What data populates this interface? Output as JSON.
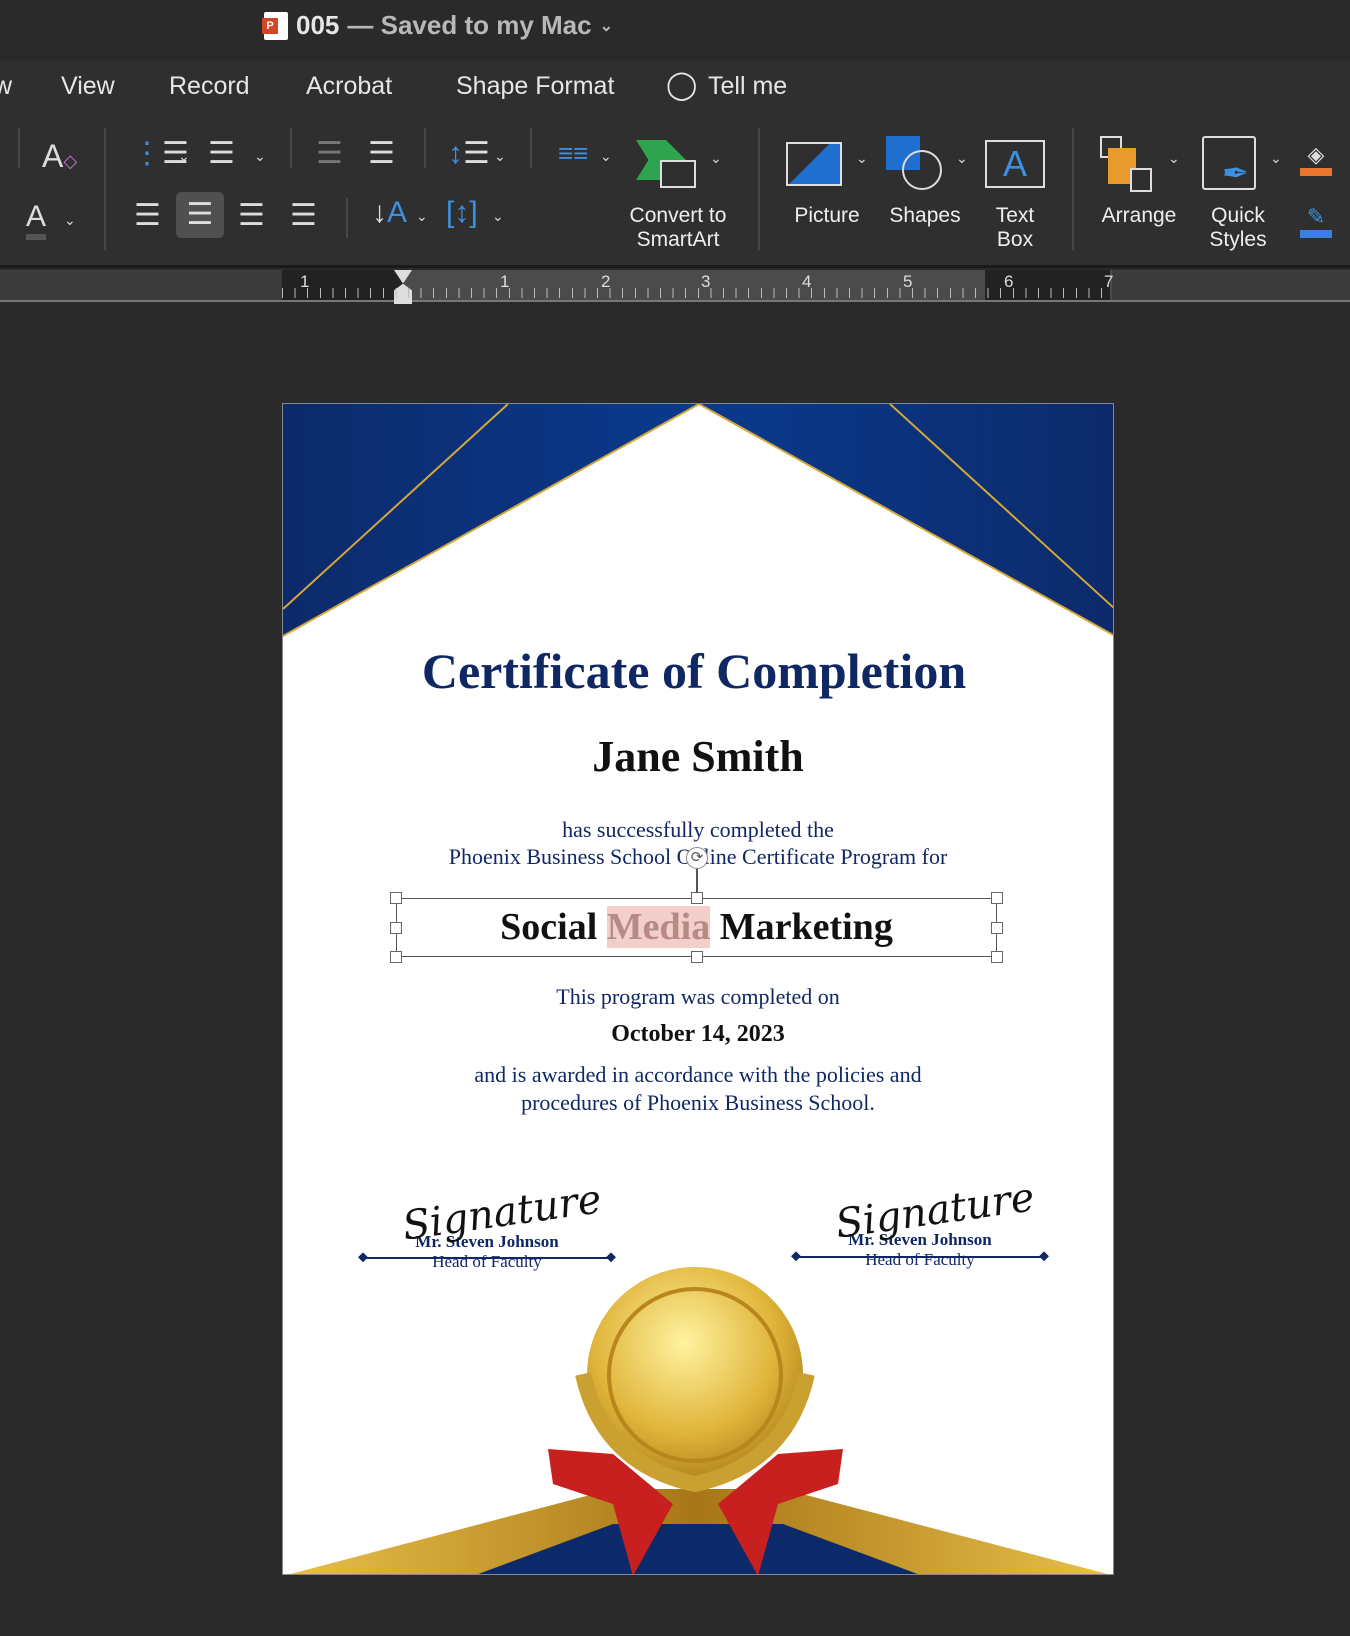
{
  "window": {
    "file_name": "005",
    "save_status": "— Saved to my Mac"
  },
  "menu": {
    "items": [
      "w",
      "View",
      "Record",
      "Acrobat",
      "Shape Format"
    ],
    "tell_me": "Tell me"
  },
  "ribbon": {
    "convert_smartart": [
      "Convert to",
      "SmartArt"
    ],
    "picture": "Picture",
    "shapes": "Shapes",
    "text_box": [
      "Text",
      "Box"
    ],
    "arrange": "Arrange",
    "quick_styles": [
      "Quick",
      "Styles"
    ]
  },
  "ruler": {
    "labels": [
      "1",
      "1",
      "2",
      "3",
      "4",
      "5",
      "6",
      "7"
    ]
  },
  "certificate": {
    "title": "Certificate of Completion",
    "recipient": "Jane Smith",
    "line1": "has successfully completed the",
    "line2": "Phoenix Business School Online Certificate Program for",
    "program_words": [
      "Social",
      "Media",
      "Marketing"
    ],
    "completed_on": "This program was completed on",
    "date": "October 14, 2023",
    "award1": "and is awarded in accordance with the policies and",
    "award2": "procedures of Phoenix Business School.",
    "signatures": [
      {
        "signature": "Signature",
        "name": "Mr. Steven Johnson",
        "role": "Head of Faculty"
      },
      {
        "signature": "Signature",
        "name": "Mr. Steven Johnson",
        "role": "Head of Faculty"
      }
    ]
  },
  "colors": {
    "navy": "#0f2763",
    "gold": "#d4a838",
    "ribbon_red": "#c8201f",
    "highlight": "#f3cfcb"
  }
}
